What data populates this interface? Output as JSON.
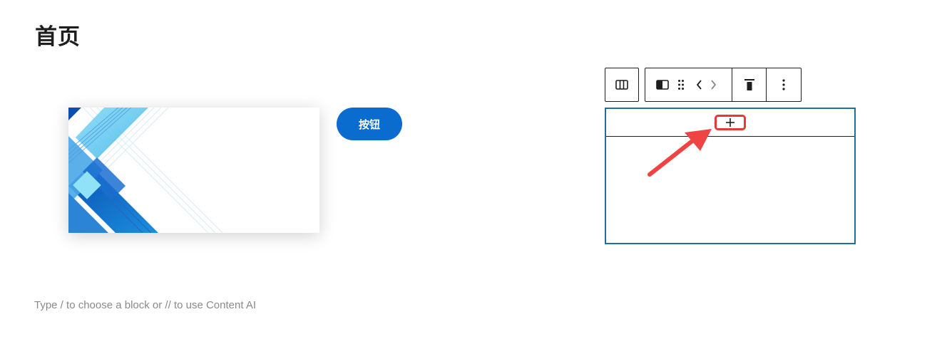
{
  "page": {
    "title": "首页",
    "placeholder": "Type / to choose a block or // to use Content AI"
  },
  "button_block": {
    "label": "按钮",
    "color": "#0a6cce"
  },
  "toolbar": {
    "buttons": [
      {
        "icon": "columns-icon",
        "label": "Columns"
      },
      {
        "icon": "column-icon",
        "label": "Column"
      },
      {
        "icon": "drag-handle-icon",
        "label": "Drag"
      },
      {
        "icon": "move-left-icon",
        "label": "Move left"
      },
      {
        "icon": "move-right-icon",
        "label": "Move right"
      },
      {
        "icon": "align-top-icon",
        "label": "Change vertical alignment"
      },
      {
        "icon": "more-options-icon",
        "label": "Options"
      }
    ]
  },
  "appender": {
    "icon": "plus-icon",
    "label": "+"
  },
  "colors": {
    "accent": "#1f6fa3",
    "highlight": "#e53935",
    "text": "#1e1e1e",
    "muted": "#8a8a8a"
  }
}
